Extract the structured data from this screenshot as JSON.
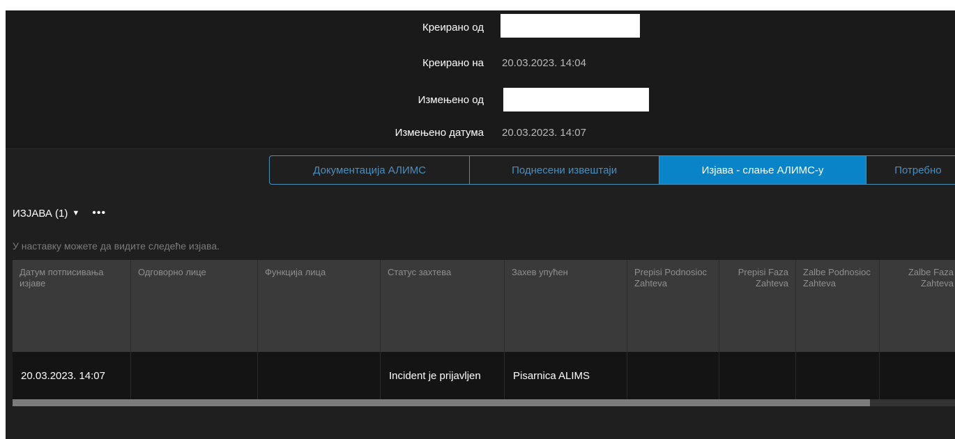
{
  "meta": {
    "created_by_label": "Креирано од",
    "created_by_value": "",
    "created_on_label": "Креирано на",
    "created_on_value": "20.03.2023. 14:04",
    "modified_by_label": "Измењено од",
    "modified_by_value": "",
    "modified_on_label": "Измењено датума",
    "modified_on_value": "20.03.2023. 14:07"
  },
  "tabs": [
    {
      "label": "Документација АЛИМС",
      "active": false
    },
    {
      "label": "Поднесени извештаји",
      "active": false
    },
    {
      "label": "Изјава - слање АЛИМС-у",
      "active": true
    },
    {
      "label": "Потребно",
      "active": false
    }
  ],
  "section": {
    "title": "ИЗЈАВА (1)",
    "caret_icon": "caret-down-icon",
    "more_icon": "more-icon",
    "description": "У наставку можете да видите следеће изјава."
  },
  "table": {
    "columns": [
      "Датум потписивања изјаве",
      "Одговорно лице",
      "Функција лица",
      "Статус захтева",
      "Захев упућен",
      "Prepisi Podnosioc Zahteva",
      "Prepisi Faza Zahteva",
      "Zalbe Podnosioc Zahteva",
      "Zalbe Faza Zahteva"
    ],
    "rows": [
      [
        "20.03.2023. 14:07",
        "",
        "",
        "Incident je prijavljen",
        "Pisarnica ALIMS",
        "",
        "",
        "",
        ""
      ]
    ]
  },
  "scrollbar": {
    "position": 0.91
  },
  "colors": {
    "background": "#1f1f1f",
    "accent": "#0a84c8",
    "tab_text": "#4a8fc0",
    "header_bg": "#3a3a3a",
    "row_bg": "#141414"
  }
}
